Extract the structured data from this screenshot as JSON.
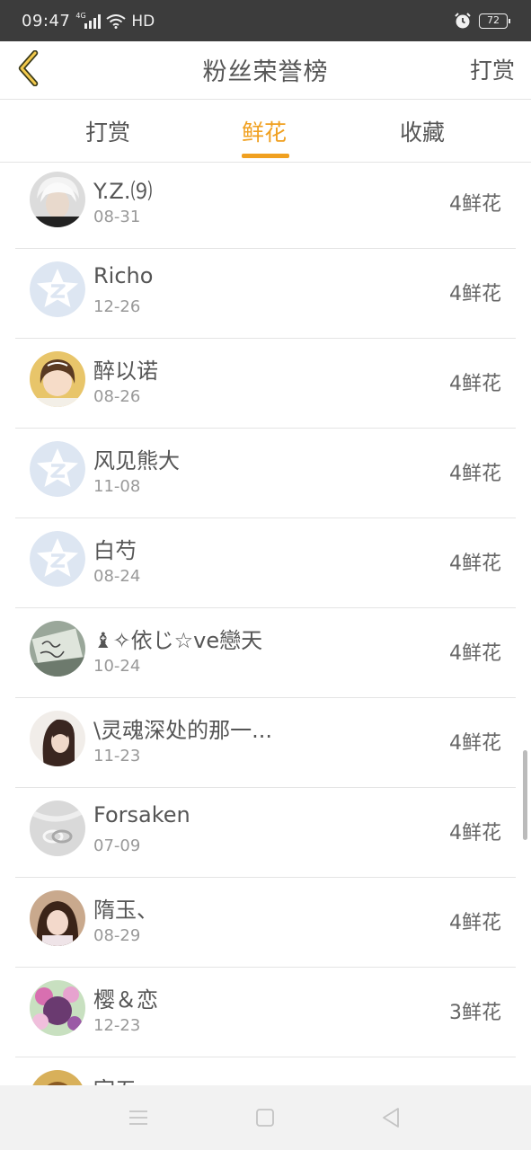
{
  "status_bar": {
    "time": "09:47",
    "network": "4G",
    "hd": "HD",
    "battery": "72"
  },
  "header": {
    "title": "粉丝荣誉榜",
    "action": "打赏"
  },
  "tabs": [
    {
      "label": "打赏",
      "active": false
    },
    {
      "label": "鲜花",
      "active": true
    },
    {
      "label": "收藏",
      "active": false
    }
  ],
  "fans": [
    {
      "name": "Y.Z.⑼",
      "date": "08-31",
      "count": "4鲜花",
      "avatar": "photo-silver-hair"
    },
    {
      "name": "Richo",
      "date": "12-26",
      "count": "4鲜花",
      "avatar": "default-qq-star"
    },
    {
      "name": "醉以诺",
      "date": "08-26",
      "count": "4鲜花",
      "avatar": "photo-girl"
    },
    {
      "name": "风见熊大",
      "date": "11-08",
      "count": "4鲜花",
      "avatar": "default-qq-star"
    },
    {
      "name": "白芍",
      "date": "08-24",
      "count": "4鲜花",
      "avatar": "default-qq-star"
    },
    {
      "name": "♝✧依じ☆ve戀天",
      "date": "10-24",
      "count": "4鲜花",
      "avatar": "photo-handwriting"
    },
    {
      "name": "\\灵魂深处的那一...",
      "date": "11-23",
      "count": "4鲜花",
      "avatar": "photo-girl-dark-hair"
    },
    {
      "name": "Forsaken",
      "date": "07-09",
      "count": "4鲜花",
      "avatar": "photo-rings"
    },
    {
      "name": "隋玉、",
      "date": "08-29",
      "count": "4鲜花",
      "avatar": "photo-girl-2"
    },
    {
      "name": "樱＆恋",
      "date": "12-23",
      "count": "3鲜花",
      "avatar": "photo-flowers"
    },
    {
      "name": "宇五",
      "date": "",
      "count": "",
      "avatar": "photo-partial"
    }
  ],
  "colors": {
    "accent": "#f0a020",
    "text": "#555555",
    "subtext": "#999999",
    "divider": "#e4e4e4",
    "status_bar": "#3c3c3c"
  },
  "icons": {
    "back": "chevron-left-icon",
    "menu": "menu-icon",
    "home": "home-square-icon",
    "back_nav": "back-triangle-icon"
  }
}
